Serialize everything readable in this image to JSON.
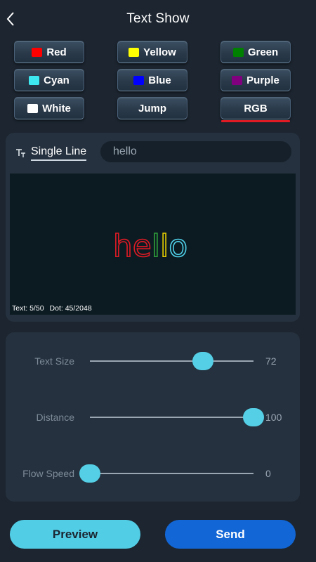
{
  "header": {
    "title": "Text Show"
  },
  "colors": [
    {
      "label": "Red",
      "swatch": "#ff0000"
    },
    {
      "label": "Yellow",
      "swatch": "#ffff00"
    },
    {
      "label": "Green",
      "swatch": "#008000"
    },
    {
      "label": "Cyan",
      "swatch": "#3de8f0"
    },
    {
      "label": "Blue",
      "swatch": "#0000ff"
    },
    {
      "label": "Purple",
      "swatch": "#800080"
    },
    {
      "label": "White",
      "swatch": "#ffffff"
    },
    {
      "label": "Jump"
    },
    {
      "label": "RGB",
      "selected": true
    }
  ],
  "editor": {
    "mode_label": "Single Line",
    "text_value": "hello",
    "preview_text": "hello",
    "preview_letter_colors": [
      "#e01b24",
      "#e01b24",
      "#2e9e3a",
      "#e8d000",
      "#4fd0e8"
    ],
    "text_count_label": "Text: 5/50",
    "dot_count_label": "Dot: 45/2048"
  },
  "sliders": [
    {
      "label": "Text Size",
      "value": "72",
      "level": 0.69
    },
    {
      "label": "Distance",
      "value": "100",
      "level": 1.0
    },
    {
      "label": "Flow Speed",
      "value": "0",
      "level": 0.0
    }
  ],
  "actions": {
    "preview_label": "Preview",
    "send_label": "Send"
  }
}
